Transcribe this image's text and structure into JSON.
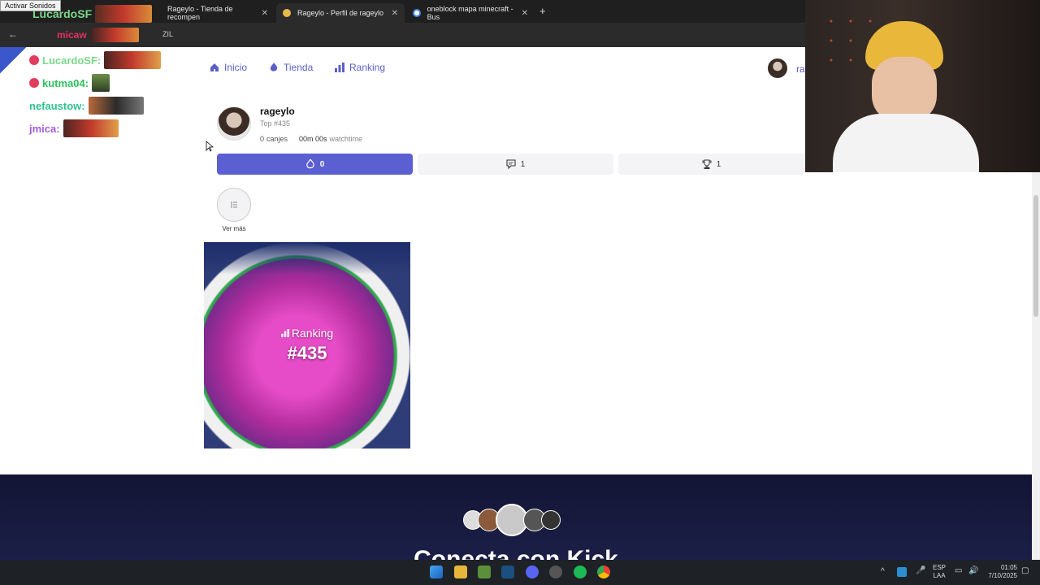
{
  "browser": {
    "sound_badge": "Activar Sonidos",
    "tabs": [
      {
        "label": "Rageylo - Tienda de recompen"
      },
      {
        "label": "Rageylo - Perfil de rageylo"
      },
      {
        "label": "oneblock mapa minecraft - Bus"
      }
    ],
    "address_fragment": "ZIL"
  },
  "chat": [
    {
      "user": "LucardoSF:",
      "color": "#7bd88a"
    },
    {
      "user": "kutma04:",
      "color": "#2bc45a"
    },
    {
      "user": "nefaustow:",
      "color": "#30c48d"
    },
    {
      "user": "jmica:",
      "color": "#a25bd9"
    }
  ],
  "chat_top": [
    {
      "user": "LucardoSF",
      "color": "#7bd88a"
    },
    {
      "user": "micaw",
      "color": "#e2315c"
    }
  ],
  "nav": {
    "home": "Inicio",
    "shop": "Tienda",
    "ranking": "Ranking",
    "user_short": "ra"
  },
  "profile": {
    "username": "rageylo",
    "rank": "Top #435",
    "canjes_count": "0",
    "canjes_label": "canjes",
    "watch_value": "00m 00s",
    "watch_label": "watchtime"
  },
  "stats": {
    "points": "0",
    "comments": "1",
    "trophies": "1"
  },
  "ver_mas": "Ver más",
  "card": {
    "label": "Ranking",
    "rank": "#435"
  },
  "footer": {
    "title": "Conecta con Kick"
  },
  "tray": {
    "lang_top": "ESP",
    "lang_bottom": "LAA",
    "time": "01:05",
    "date": "7/10/2025"
  }
}
